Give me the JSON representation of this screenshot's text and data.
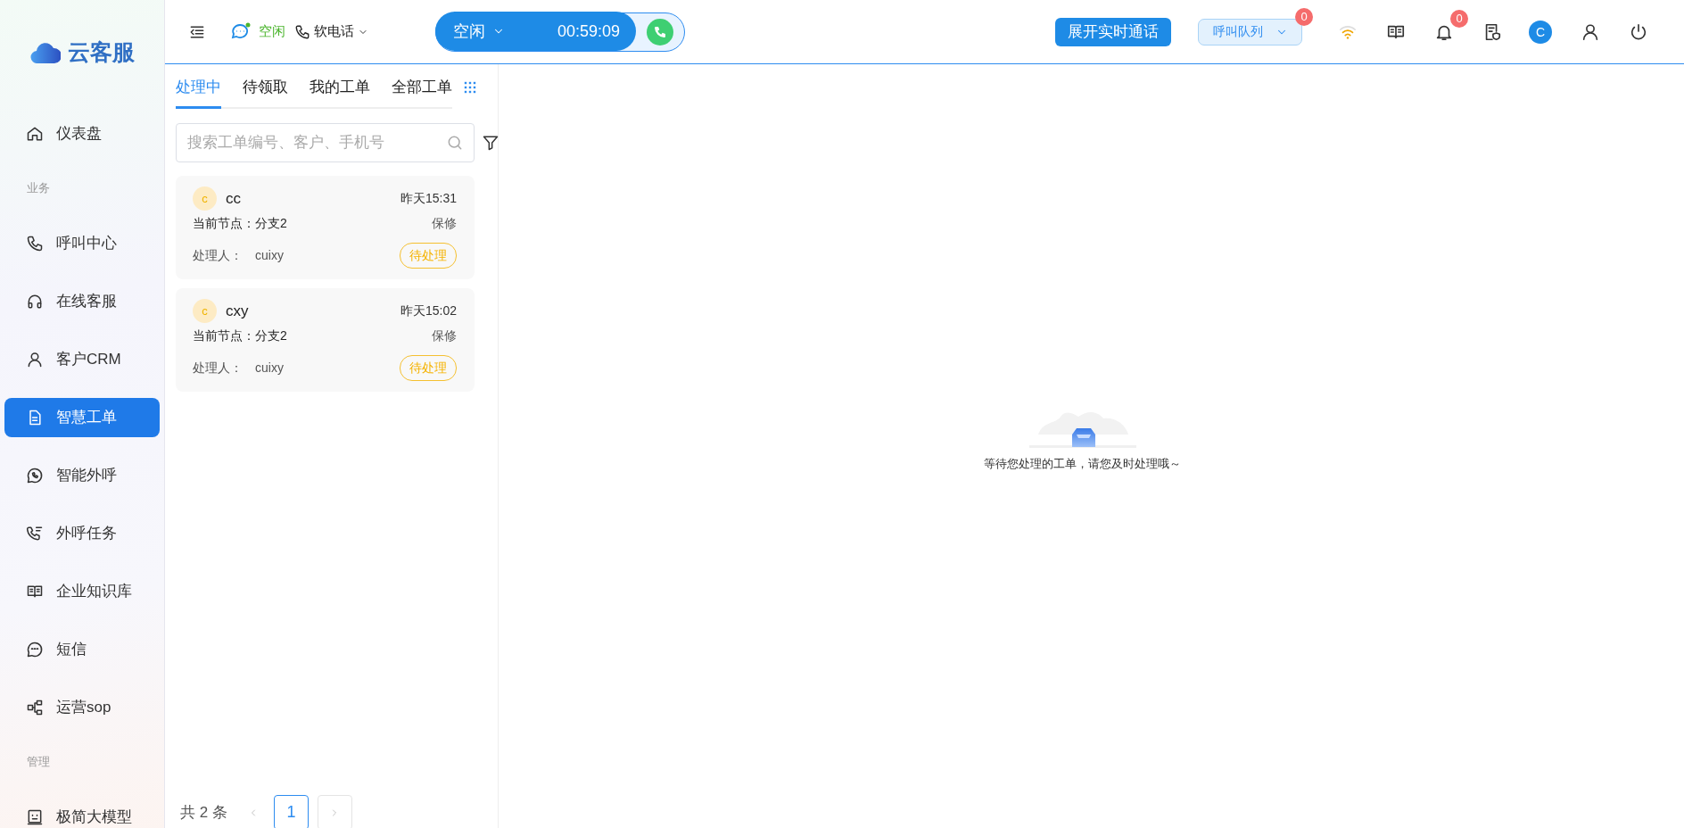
{
  "brand": {
    "name": "云客服"
  },
  "sidebar": {
    "items": [
      {
        "kind": "item",
        "label": "仪表盘",
        "selected": false
      },
      {
        "kind": "section",
        "label": "业务"
      },
      {
        "kind": "item",
        "label": "呼叫中心",
        "selected": false
      },
      {
        "kind": "item",
        "label": "在线客服",
        "selected": false
      },
      {
        "kind": "item",
        "label": "客户CRM",
        "selected": false
      },
      {
        "kind": "item",
        "label": "智慧工单",
        "selected": true
      },
      {
        "kind": "item",
        "label": "智能外呼",
        "selected": false
      },
      {
        "kind": "item",
        "label": "外呼任务",
        "selected": false
      },
      {
        "kind": "item",
        "label": "企业知识库",
        "selected": false
      },
      {
        "kind": "item",
        "label": "短信",
        "selected": false
      },
      {
        "kind": "item",
        "label": "运营sop",
        "selected": false
      },
      {
        "kind": "section",
        "label": "管理"
      },
      {
        "kind": "item",
        "label": "极简大模型",
        "selected": false
      }
    ]
  },
  "topbar": {
    "presence_label": "空闲",
    "phone_mode": "软电话",
    "agent_status": "空闲",
    "timer": "00:59:09",
    "expand_button": "展开实时通话",
    "queue_button": "呼叫队列",
    "queue_badge": "0",
    "notification_badge": "0",
    "avatar_letter": "C"
  },
  "ticket_panel": {
    "tabs": [
      {
        "label": "处理中",
        "selected": true
      },
      {
        "label": "待领取",
        "selected": false
      },
      {
        "label": "我的工单",
        "selected": false
      },
      {
        "label": "全部工单",
        "selected": false
      }
    ],
    "search": {
      "placeholder": "搜索工单编号、客户、手机号"
    },
    "tickets": [
      {
        "avatar": "c",
        "name": "cc",
        "time": "昨天15:31",
        "node": "当前节点：分支2",
        "type": "保修",
        "handler_label": "处理人：",
        "handler": "cuixy",
        "status": "待处理"
      },
      {
        "avatar": "c",
        "name": "cxy",
        "time": "昨天15:02",
        "node": "当前节点：分支2",
        "type": "保修",
        "handler_label": "处理人：",
        "handler": "cuixy",
        "status": "待处理"
      }
    ],
    "pagination": {
      "total": "共 2 条",
      "pages": [
        {
          "label": "1",
          "selected": true
        }
      ]
    }
  },
  "empty_state": {
    "message": "等待您处理的工单，请您及时处理哦～"
  }
}
